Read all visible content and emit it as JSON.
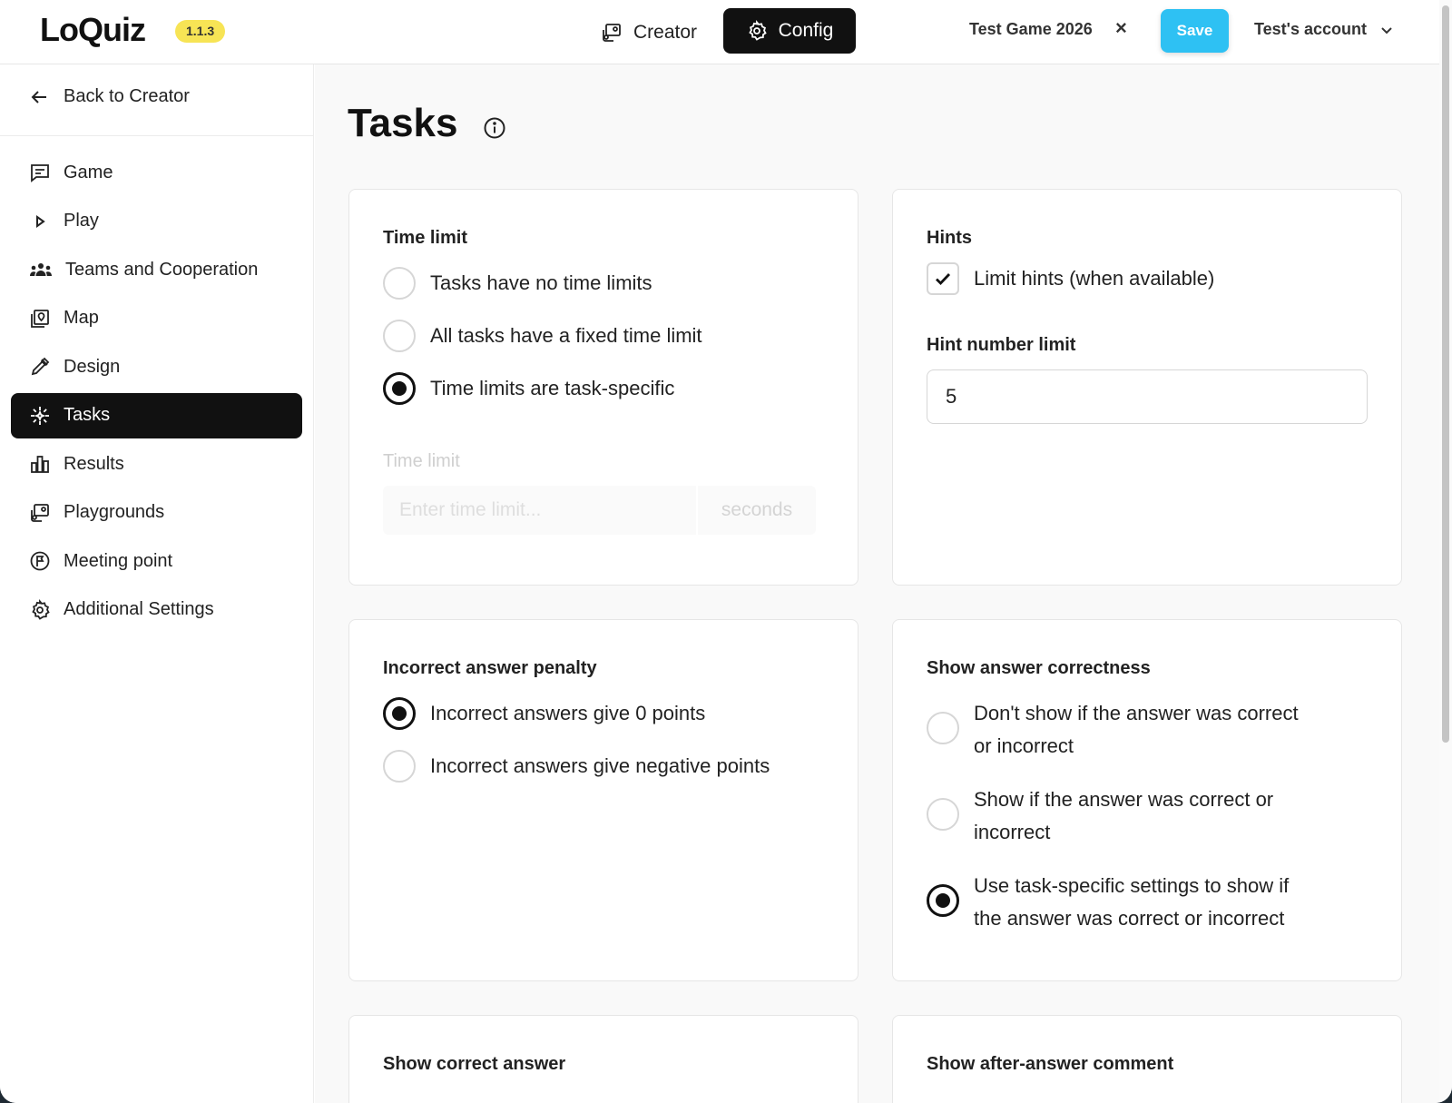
{
  "header": {
    "logo": "LoQuiz",
    "version": "1.1.3",
    "creator_label": "Creator",
    "config_label": "Config",
    "game_title": "Test Game 2026",
    "close_symbol": "×",
    "save_label": "Save",
    "account_label": "Test's account"
  },
  "sidebar": {
    "back_label": "Back to Creator",
    "items": [
      {
        "label": "Game",
        "icon": "message-square-icon"
      },
      {
        "label": "Play",
        "icon": "play-icon"
      },
      {
        "label": "Teams and Cooperation",
        "icon": "users-icon"
      },
      {
        "label": "Map",
        "icon": "map-pin-icon"
      },
      {
        "label": "Design",
        "icon": "pipette-icon"
      },
      {
        "label": "Tasks",
        "icon": "sparkle-icon",
        "active": true
      },
      {
        "label": "Results",
        "icon": "bar-chart-icon"
      },
      {
        "label": "Playgrounds",
        "icon": "playground-icon"
      },
      {
        "label": "Meeting point",
        "icon": "flag-circle-icon"
      },
      {
        "label": "Additional Settings",
        "icon": "gear-icon"
      }
    ]
  },
  "main": {
    "title": "Tasks",
    "time_limit_card": {
      "title": "Time limit",
      "options": [
        {
          "label": "Tasks have no time limits",
          "selected": false
        },
        {
          "label": "All tasks have a fixed time limit",
          "selected": false
        },
        {
          "label": "Time limits are task-specific",
          "selected": true
        }
      ],
      "field_label": "Time limit",
      "field_placeholder": "Enter time limit...",
      "field_unit": "seconds"
    },
    "hints_card": {
      "title": "Hints",
      "checkbox_label": "Limit hints (when available)",
      "checkbox_checked": true,
      "field_label": "Hint number limit",
      "field_value": "5"
    },
    "penalty_card": {
      "title": "Incorrect answer penalty",
      "options": [
        {
          "label": "Incorrect answers give 0 points",
          "selected": true
        },
        {
          "label": "Incorrect answers give negative points",
          "selected": false
        }
      ]
    },
    "correctness_card": {
      "title": "Show answer correctness",
      "options": [
        {
          "line1": "Don't show if the answer was correct",
          "line2": "or incorrect",
          "selected": false
        },
        {
          "line1": "Show if the answer was correct or",
          "line2": "incorrect",
          "selected": false
        },
        {
          "line1": "Use task-specific settings to show if",
          "line2": "the answer was correct or incorrect",
          "selected": true
        }
      ]
    },
    "correct_answer_card": {
      "title": "Show correct answer"
    },
    "comment_card": {
      "title": "Show after-answer comment"
    }
  }
}
